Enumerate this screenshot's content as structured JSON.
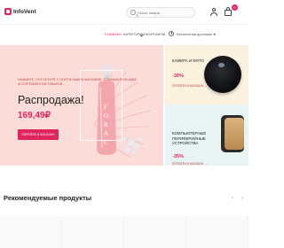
{
  "header": {
    "logo_text": "InfoVent",
    "search_placeholder": "Поиск товара",
    "cart_count": "0"
  },
  "nav": {
    "items": [
      "Главная",
      "Категории",
      "Контакты"
    ],
    "delivery": "Бесплатная доставка ★"
  },
  "hero": {
    "promo_text": "Нажмите, что хотите у себя в нашем магазине. С самым большим ассортиментом товаров.",
    "title": "Распродажа!",
    "price": "169,49₽",
    "button_label": "Перейти в магазин",
    "bottle_label": "FORAL"
  },
  "cards": [
    {
      "title": "Камера и фото",
      "discount": "-30%",
      "link": "Перейти в магазин →",
      "image_icon": "camera-icon"
    },
    {
      "title": "Компьютерные периферийные устройства",
      "discount": "-35%",
      "link": "Перейти в магазин →",
      "image_icon": "speaker-icon"
    }
  ],
  "recommended": {
    "title": "Рекомендуемые продукты",
    "prev_icon": "‹",
    "next_icon": "›"
  },
  "colors": {
    "accent": "#e0245e",
    "hero_bg": "#fbdcd8",
    "card_camera_bg": "#fbf1df",
    "card_periph_bg": "#e8f3f3"
  }
}
